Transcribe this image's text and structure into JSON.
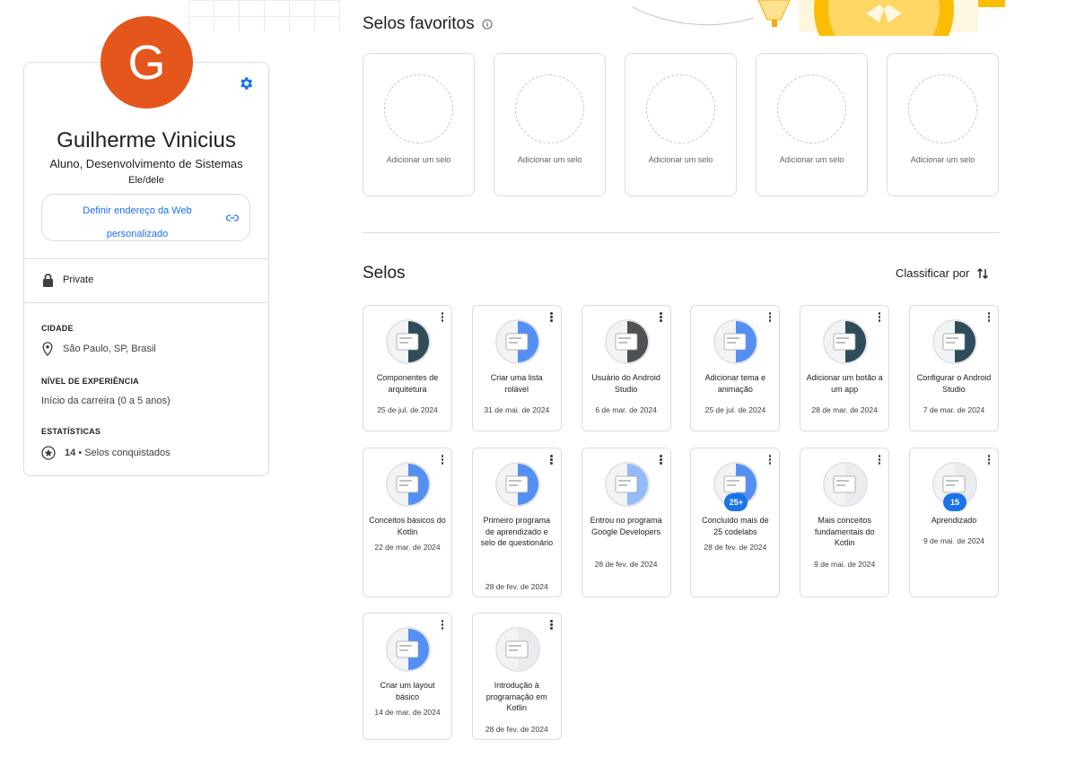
{
  "profile": {
    "initial": "G",
    "name": "Guilherme Vinicius",
    "role": "Aluno, Desenvolvimento de Sistemas",
    "pronouns": "Ele/dele",
    "url_button_line1": "Definir endereço da Web",
    "url_button_line2": "personalizado",
    "privacy": "Private",
    "city_heading": "CIDADE",
    "city": "São Paulo, SP, Brasil",
    "experience_heading": "NÍVEL DE EXPERIÊNCIA",
    "experience": "Início da carreira (0 a 5 anos)",
    "stats_heading": "ESTATÍSTICAS",
    "stats_count": "14",
    "stats_label": "• Selos conquistados"
  },
  "favorites": {
    "title": "Selos favoritos",
    "slot_label": "Adicionar um selo",
    "slots": 5
  },
  "badges_section": {
    "title": "Selos",
    "sort_label": "Classificar por"
  },
  "badges": [
    {
      "title": "Componentes de arquitetura",
      "date": "25 de jul. de 2024",
      "color": "#1a3a4a"
    },
    {
      "title": "Criar uma lista rolável",
      "date": "31 de mai. de 2024",
      "color": "#4285f4"
    },
    {
      "title": "Usuário do Android Studio",
      "date": "6 de mar. de 2024",
      "color": "#3c4043"
    },
    {
      "title": "Adicionar tema e animação",
      "date": "25 de jul. de 2024",
      "color": "#4285f4"
    },
    {
      "title": "Adicionar um botão a um app",
      "date": "28 de mar. de 2024",
      "color": "#1a3a4a"
    },
    {
      "title": "Configurar o Android Studio",
      "date": "7 de mar. de 2024",
      "color": "#1a3a4a"
    },
    {
      "title": "Conceitos básicos do Kotlin",
      "date": "22 de mar. de 2024",
      "color": "#4285f4"
    },
    {
      "title": "Primeiro programa de aprendizado e selo de questionário",
      "date": "28 de fev. de 2024",
      "color": "#4285f4"
    },
    {
      "title": "Entrou no programa Google Developers",
      "date": "28 de fev. de 2024",
      "color": "#8ab4f8"
    },
    {
      "title": "Concluído mais de 25 codelabs",
      "date": "28 de fev. de 2024",
      "color": "#4285f4",
      "overlay": "25+"
    },
    {
      "title": "Mais conceitos fundamentais do Kotlin",
      "date": "9 de mai. de 2024",
      "color": "#e8eaed"
    },
    {
      "title": "Aprendizado",
      "date": "9 de mai. de 2024",
      "color": "#e8eaed",
      "overlay": "15"
    },
    {
      "title": "Criar um layout básico",
      "date": "14 de mar. de 2024",
      "color": "#4285f4"
    },
    {
      "title": "Introdução à programação em Kotlin",
      "date": "28 de fev. de 2024",
      "color": "#e8eaed"
    }
  ]
}
